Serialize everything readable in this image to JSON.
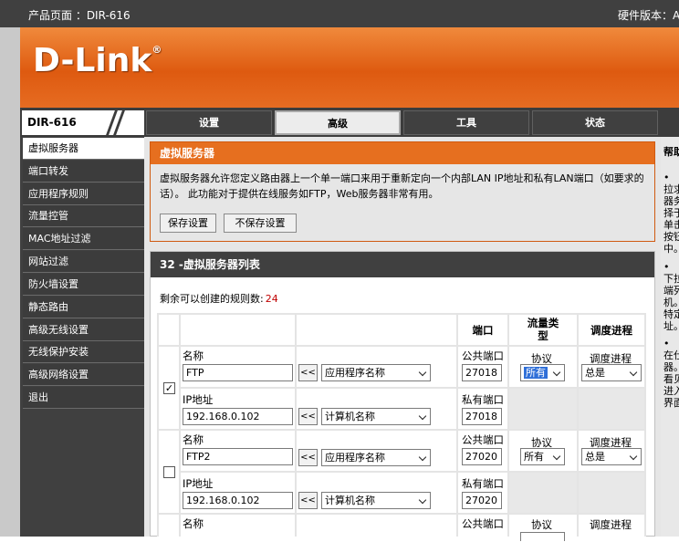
{
  "top": {
    "product_page": "产品页面 ：DIR-616",
    "hw_version": "硬件版本：A"
  },
  "brand": {
    "logo": "D-Link",
    "reg": "®",
    "model": "DIR-616"
  },
  "tabs": [
    "设置",
    "高级",
    "工具",
    "状态"
  ],
  "active_tab": 1,
  "sidebar": [
    "虚拟服务器",
    "端口转发",
    "应用程序规则",
    "流量控管",
    "MAC地址过滤",
    "网站过滤",
    "防火墙设置",
    "静态路由",
    "高级无线设置",
    "无线保护安装",
    "高级网络设置",
    "退出"
  ],
  "section1": {
    "title": "虚拟服务器",
    "desc": "虚拟服务器允许您定义路由器上一个单一端口来用于重新定向一个内部LAN IP地址和私有LAN端口（如要求的话）。 此功能对于提供在线服务如FTP，Web服务器非常有用。",
    "save": "保存设置",
    "nosave": "不保存设置"
  },
  "section2": {
    "title": "32 -虚拟服务器列表",
    "remaining_label": "剩余可以创建的规则数:",
    "remaining_count": "24"
  },
  "table": {
    "h_port": "端口",
    "h_traffic": "流量类型",
    "h_schedule": "调度进程",
    "l_name": "名称",
    "l_ip": "IP地址",
    "l_public": "公共端口",
    "l_private": "私有端口",
    "l_protocol": "协议",
    "l_schedule": "调度进程",
    "add": "<<",
    "app_select": "应用程序名称",
    "pc_select": "计算机名称",
    "rows": [
      {
        "checked": "✓",
        "name": "FTP",
        "ip": "192.168.0.102",
        "public": "27018",
        "private": "27018",
        "protocol": "所有",
        "schedule": "总是"
      },
      {
        "checked": "",
        "name": "FTP2",
        "ip": "192.168.0.102",
        "public": "27020",
        "private": "27020",
        "protocol": "所有",
        "schedule": "总是"
      }
    ]
  },
  "help": {
    "title": "帮助",
    "lines1": [
      "•",
      "拉求",
      "器务",
      "择于",
      "单击",
      "按钮",
      "中。"
    ],
    "lines2": [
      "•",
      "下拉",
      "端列",
      "机。",
      "特定",
      "址。"
    ],
    "lines3": [
      "•",
      "在仕",
      "器。",
      "看见",
      "进入",
      "界面"
    ]
  }
}
